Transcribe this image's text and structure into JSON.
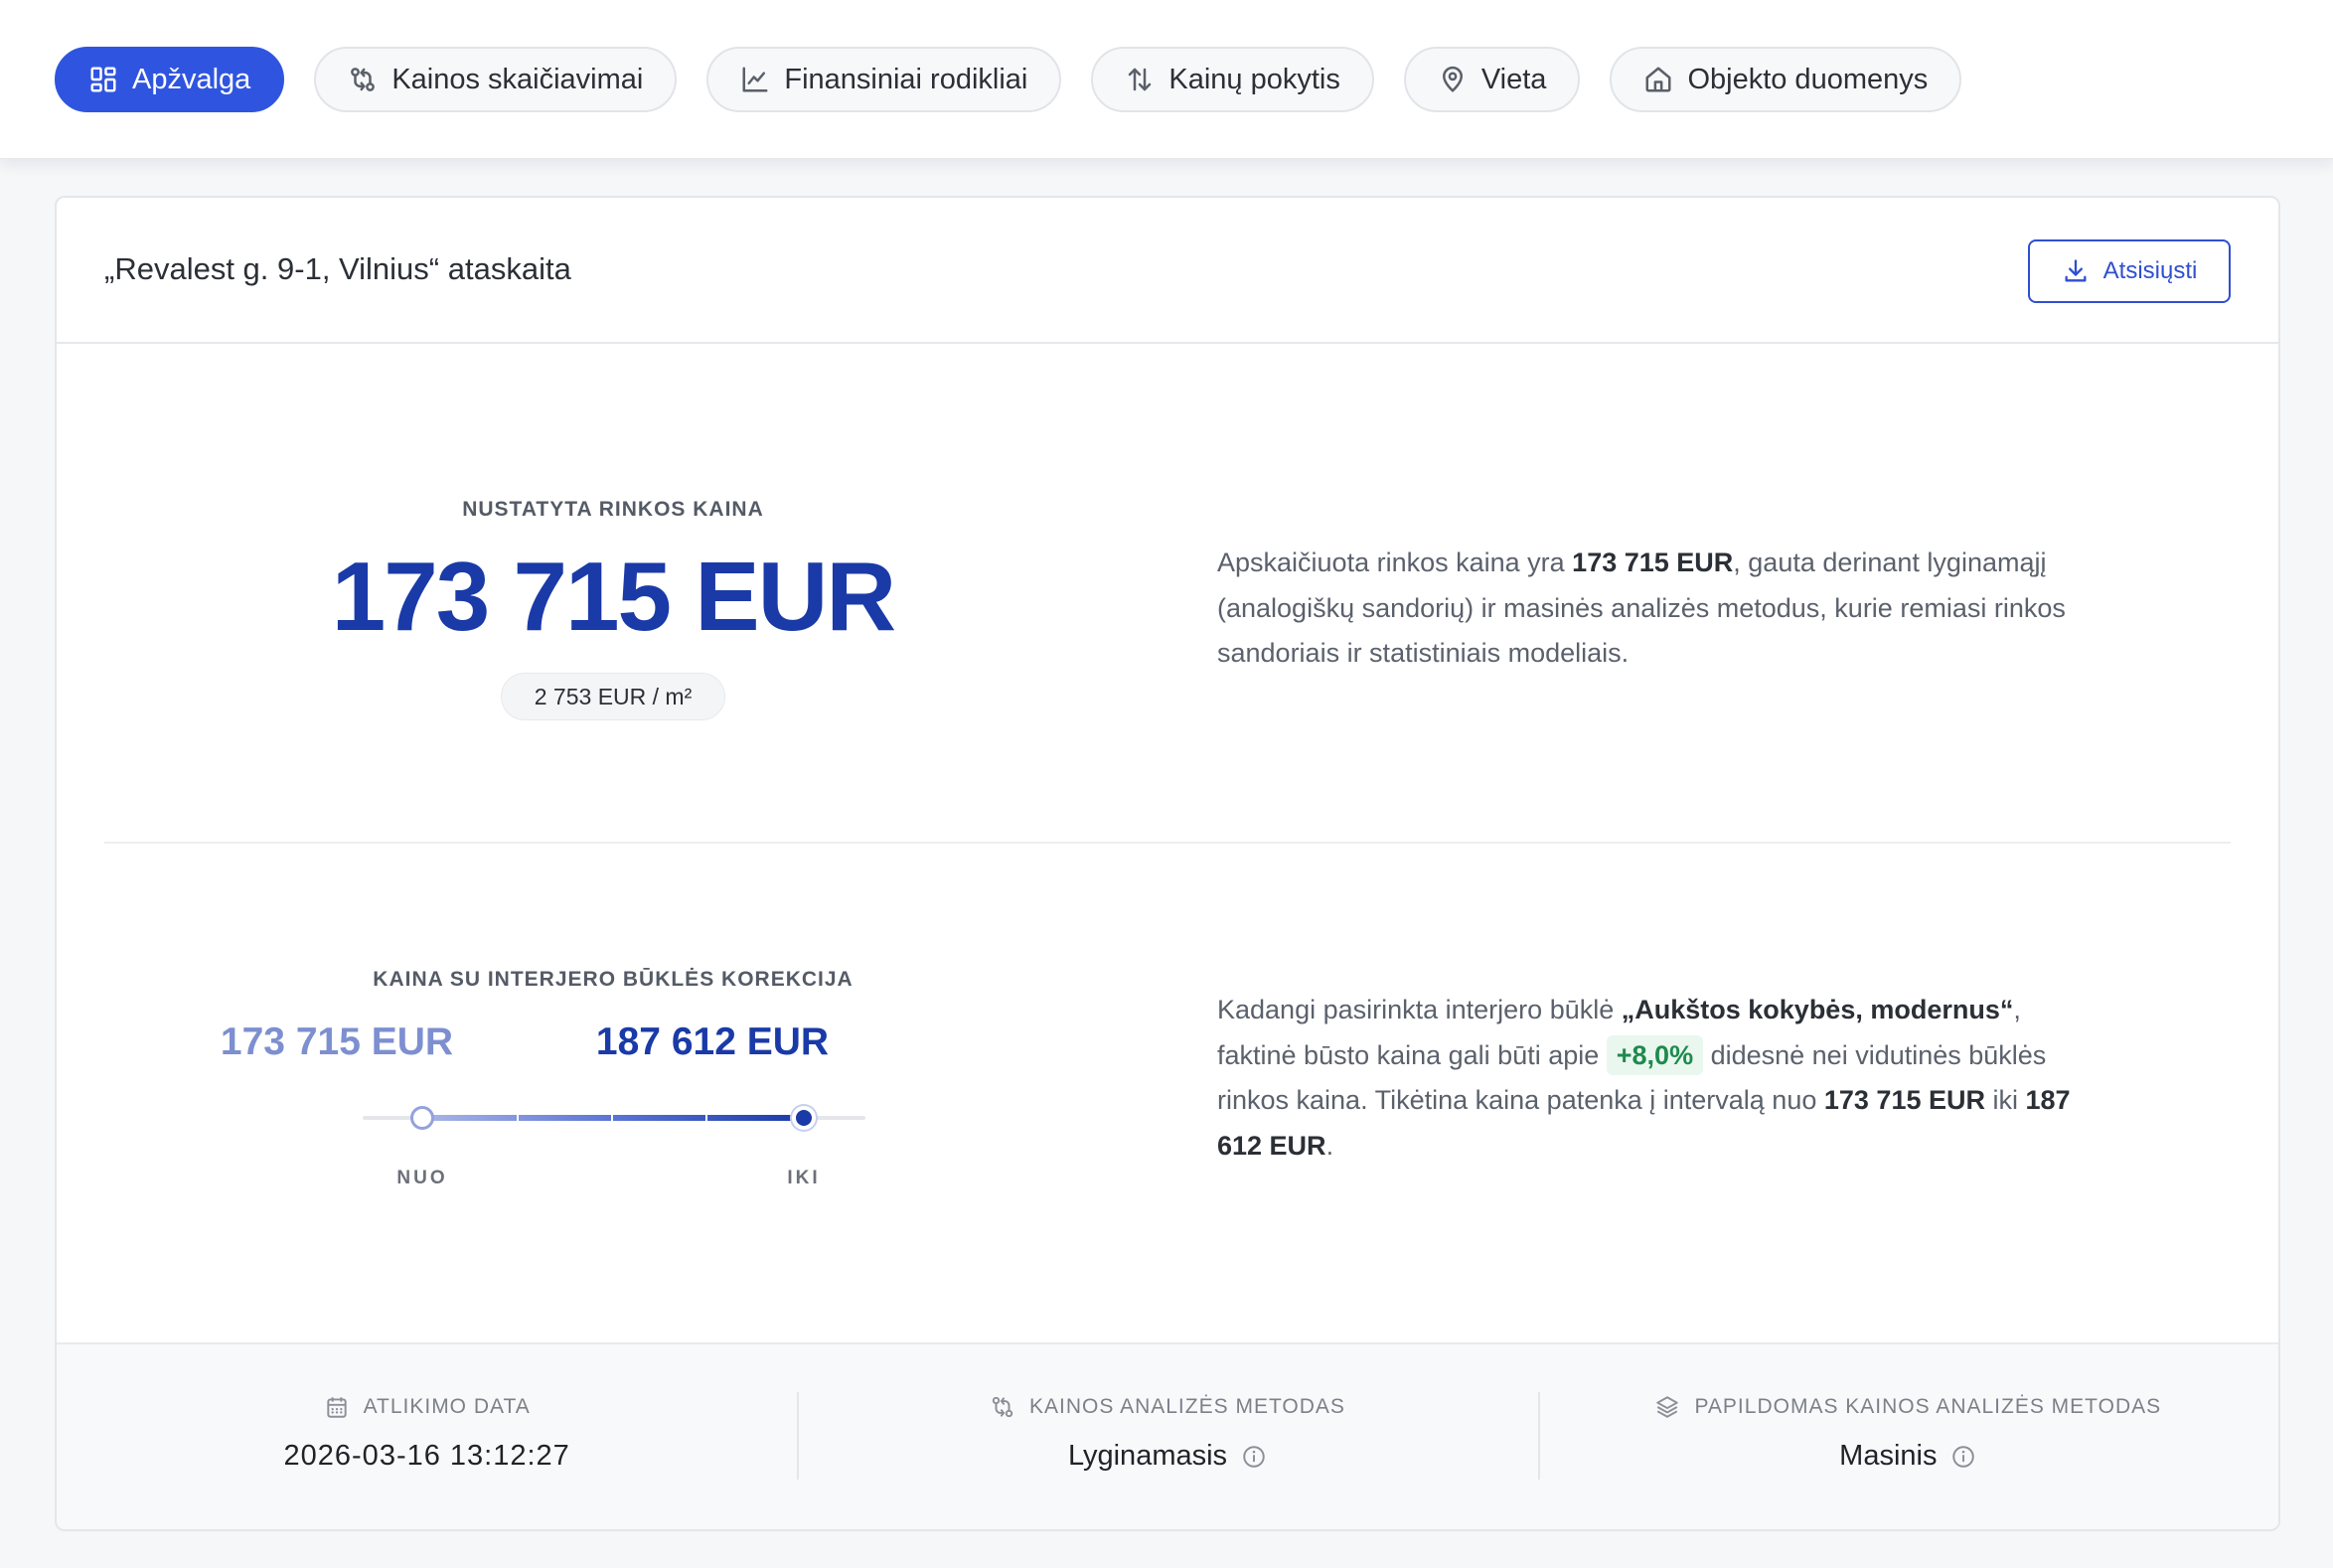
{
  "tabs": [
    {
      "label": "Apžvalga",
      "icon": "grid-icon",
      "active": true
    },
    {
      "label": "Kainos skaičiavimai",
      "icon": "git-compare-icon",
      "active": false
    },
    {
      "label": "Finansiniai rodikliai",
      "icon": "line-chart-icon",
      "active": false
    },
    {
      "label": "Kainų pokytis",
      "icon": "arrows-up-down-icon",
      "active": false
    },
    {
      "label": "Vieta",
      "icon": "map-pin-icon",
      "active": false
    },
    {
      "label": "Objekto duomenys",
      "icon": "home-icon",
      "active": false
    }
  ],
  "report": {
    "title": "„Revalest g. 9-1, Vilnius“ ataskaita",
    "download_label": "Atsisiųsti"
  },
  "market_price": {
    "label": "NUSTATYTA RINKOS KAINA",
    "value": "173 715 EUR",
    "per_m2": "2 753 EUR / m²",
    "desc_prefix": "Apskaičiuota rinkos kaina yra ",
    "desc_bold": "173 715 EUR",
    "desc_suffix": ", gauta derinant lyginamąjį (analogiškų sandorių) ir masinės analizės metodus, kurie remiasi rinkos sandoriais ir statistiniais modeliais."
  },
  "interior_correction": {
    "label": "KAINA SU INTERJERO BŪKLĖS KOREKCIJA",
    "from_value": "173 715 EUR",
    "to_value": "187 612 EUR",
    "from_label": "NUO",
    "to_label": "IKI",
    "desc_part1": "Kadangi pasirinkta interjero būklė ",
    "desc_condition": "„Aukštos kokybės, modernus“",
    "desc_part2": ", faktinė būsto kaina gali būti apie ",
    "desc_pct": "+8,0%",
    "desc_part3": " didesnė nei vidutinės būklės rinkos kaina. Tikėtina kaina patenka į intervalą nuo ",
    "desc_from": "173 715 EUR",
    "desc_part4": " iki ",
    "desc_to": "187 612 EUR",
    "desc_end": "."
  },
  "footer": {
    "date_label": "ATLIKIMO DATA",
    "date_value": "2026-03-16 13:12:27",
    "method_label": "KAINOS ANALIZĖS METODAS",
    "method_value": "Lyginamasis",
    "extra_method_label": "PAPILDOMAS KAINOS ANALIZĖS METODAS",
    "extra_method_value": "Masinis"
  },
  "colors": {
    "accent": "#2f55e0",
    "price_blue": "#1a3aa8",
    "positive_green": "#1f8a4c"
  }
}
